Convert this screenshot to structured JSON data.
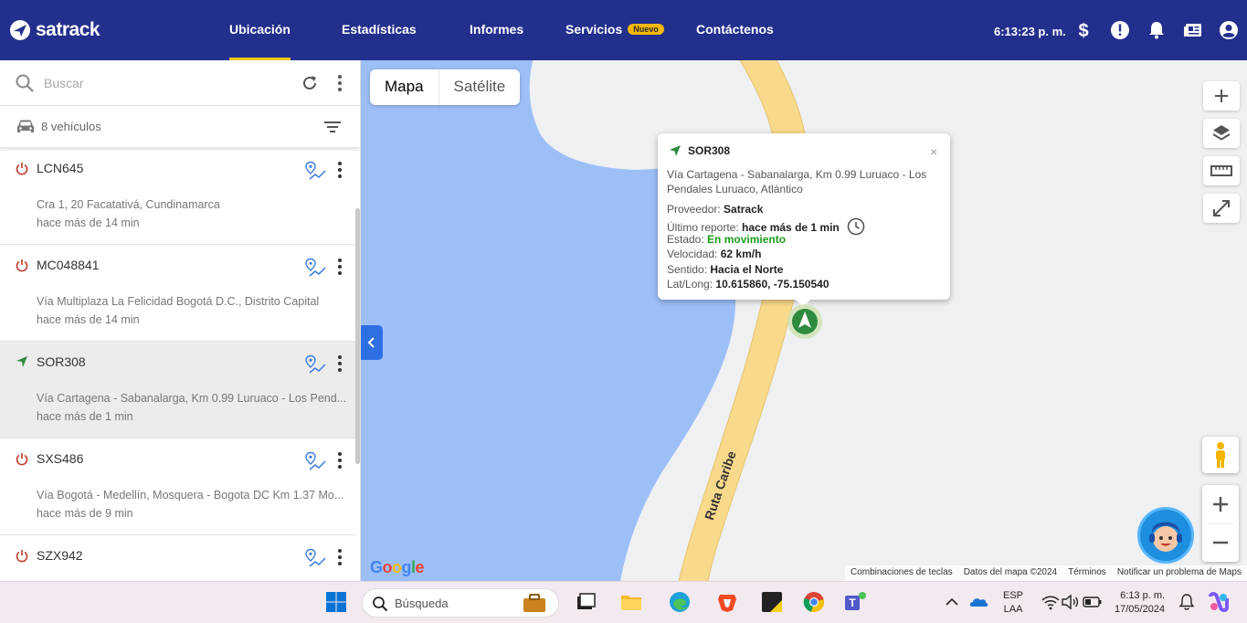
{
  "header": {
    "logo_text": "satrack",
    "nav": [
      {
        "label": "Ubicación",
        "active": true
      },
      {
        "label": "Estadísticas"
      },
      {
        "label": "Informes"
      },
      {
        "label": "Servicios",
        "badge": "Nuevo"
      },
      {
        "label": "Contáctenos"
      }
    ],
    "clock": "6:13:23 p. m.",
    "icons": [
      "dollar-icon",
      "alert-icon",
      "bell-icon",
      "news-icon",
      "user-icon"
    ],
    "brand_color": "#232f8c",
    "accent_color": "#f5c518"
  },
  "sidebar": {
    "search_placeholder": "Buscar",
    "vehicle_count": "8 vehículos",
    "vehicles": [
      {
        "plate": "LCN645",
        "address": "Cra 1, 20 Facatativá, Cundinamarca",
        "time": "hace más de 14 min",
        "status": "off"
      },
      {
        "plate": "MC048841",
        "address": "Vía Multiplaza La Felicidad Bogotá D.C., Distrito Capital",
        "time": "hace más de 14 min",
        "status": "off"
      },
      {
        "plate": "SOR308",
        "address": "Vía Cartagena - Sabanalarga, Km 0.99 Luruaco - Los Pend...",
        "time": "hace más de 1 min",
        "status": "moving",
        "selected": true
      },
      {
        "plate": "SXS486",
        "address": "Vía Bogotá - Medellín, Mosquera - Bogota DC Km 1.37 Mo...",
        "time": "hace más de 9 min",
        "status": "off"
      },
      {
        "plate": "SZX942",
        "address": "",
        "time": "",
        "status": "off"
      }
    ],
    "status_colors": {
      "off": "#c0392b",
      "moving": "#2e8b3e"
    }
  },
  "map": {
    "types": [
      "Mapa",
      "Satélite"
    ],
    "active_type": "Mapa",
    "road_label": "Ruta Caribe",
    "google": "Google",
    "footer": [
      "Combinaciones de teclas",
      "Datos del mapa ©2024",
      "Términos",
      "Notificar un problema de Maps"
    ],
    "water_color": "#9dbff8",
    "road_color": "#f9d98b"
  },
  "infowindow": {
    "plate": "SOR308",
    "address": "Vía Cartagena - Sabanalarga, Km 0.99 Luruaco - Los Pendales Luruaco, Atlántico",
    "close": "×",
    "rows": [
      {
        "label": "Proveedor: ",
        "value": "Satrack"
      },
      {
        "label": "Último reporte: ",
        "value": "hace más de 1 min"
      },
      {
        "label": "Estado: ",
        "value": "En movimiento"
      },
      {
        "label": "Velocidad: ",
        "value": "62 km/h"
      },
      {
        "label": "Sentido: ",
        "value": "Hacia el Norte"
      },
      {
        "label": "Lat/Long: ",
        "value": "10.615860, -75.150540"
      }
    ]
  },
  "taskbar": {
    "search": "Búsqueda",
    "lang_top": "ESP",
    "lang_bottom": "LAA",
    "time": "6:13 p. m.",
    "date": "17/05/2024"
  }
}
